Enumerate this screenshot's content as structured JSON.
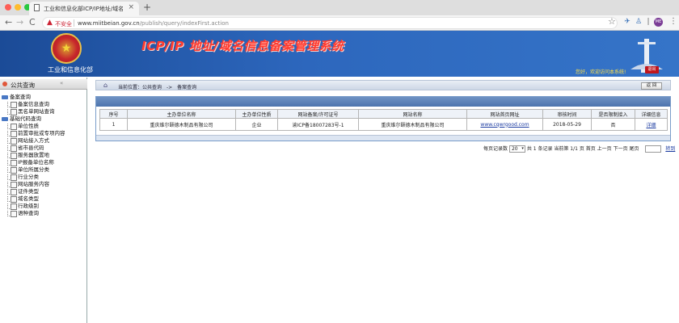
{
  "browser": {
    "tab_title": "工业和信息化部ICP/IP地址/域名信",
    "tab_close": "×",
    "new_tab": "+",
    "back": "←",
    "forward": "→",
    "reload": "C",
    "security_warning": "不安全",
    "warning_symbol": "▲",
    "url_host": "www.miitbeian.gov.cn",
    "url_path": "/publish/query/indexFirst.action",
    "star": "☆",
    "profile": "ME",
    "menu": "⋮",
    "ext_icons": [
      "puzzle-icon",
      "airplane-icon",
      "person-icon"
    ]
  },
  "banner": {
    "ministry": "工业和信息化部",
    "system_title": "ICP/IP 地址/域名信息备案管理系统",
    "welcome": "您好，欢迎访问本系统!",
    "logout": "退出",
    "emblem_glyph": "★"
  },
  "sidebar": {
    "header": "公共查询",
    "collapse": "«",
    "groups": [
      {
        "label": "备案查询",
        "items": [
          "备案信息查询",
          "黑名单网站查询"
        ]
      },
      {
        "label": "基础代码查询",
        "items": [
          "单位性质",
          "前置审批或专项内容",
          "网站接入方式",
          "省市县代码",
          "服务器放置地",
          "IP报备单位名称",
          "单位所属分类",
          "行业分类",
          "网站服务内容",
          "证件类型",
          "域名类型",
          "行政级别",
          "语种查询"
        ]
      }
    ]
  },
  "main": {
    "crumb": [
      "当前位置：公共查询",
      "->",
      "备案查询"
    ],
    "back_button": "返 回",
    "table": {
      "columns": [
        "序号",
        "主办单位名称",
        "主办单位性质",
        "网站备案/许可证号",
        "网站名称",
        "网站首页网址",
        "审核时间",
        "是否限制接入",
        "详细信息"
      ],
      "rows": [
        [
          "1",
          "重庆维尔颐德木制品有限公司",
          "企业",
          "渝ICP备18007283号-1",
          "重庆维尔颐德木制品有限公司",
          "www.cqwrgood.com",
          "2018-05-29",
          "否",
          "详细"
        ]
      ]
    },
    "pager": {
      "per_page_label": "每页记录数",
      "per_page_value": "20",
      "summary": "共 1 条记录  当前第 1/1 页  首页  上一页  下一页  尾页",
      "go": "转到"
    }
  },
  "colors": {
    "banner_blue": "#2d67bd",
    "title_red": "#ff3b2f",
    "link_blue": "#1a3aa0",
    "logout_red": "#c0161c"
  }
}
